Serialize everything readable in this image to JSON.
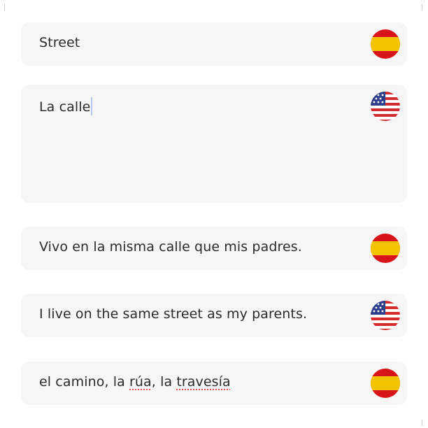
{
  "cards": {
    "term": {
      "text": "Street",
      "flag": "spain-flag-icon"
    },
    "translation": {
      "text": "La calle",
      "flag": "us-flag-icon"
    },
    "example_es": {
      "text": "Vivo en la misma calle que mis padres.",
      "flag": "spain-flag-icon"
    },
    "example_en": {
      "text": "I live on the same street as my parents.",
      "flag": "us-flag-icon"
    },
    "synonyms": {
      "parts": [
        "el camino, la ",
        "rúa",
        ", la ",
        "travesía"
      ],
      "flag": "spain-flag-icon"
    }
  },
  "colors": {
    "card_bg": "#f6f6f6",
    "text": "#2b2b2b",
    "caret": "#b9c7f5",
    "spell_underline": "#e05656",
    "spain_red": "#d7141a",
    "spain_yellow": "#f5c400",
    "us_red": "#d42a2e",
    "us_blue": "#2c3e8c"
  }
}
